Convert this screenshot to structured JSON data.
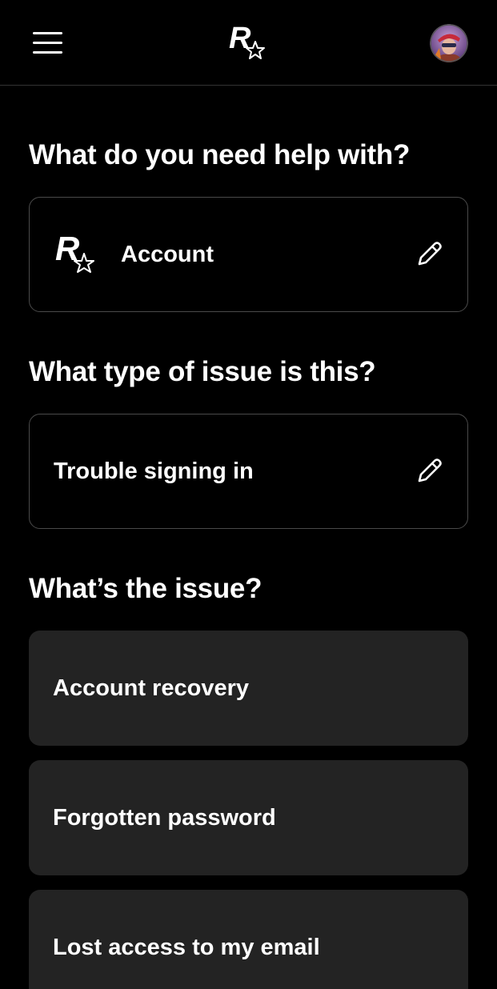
{
  "header": {
    "menu_icon": "hamburger-menu-icon",
    "logo_icon": "rockstar-logo-icon",
    "avatar_icon": "user-avatar"
  },
  "help_topic": {
    "title": "What do you need help with?",
    "selected_label": "Account",
    "edit_icon": "pencil-icon"
  },
  "issue_type": {
    "title": "What type of issue is this?",
    "selected_label": "Trouble signing in",
    "edit_icon": "pencil-icon"
  },
  "issue": {
    "title": "What’s the issue?",
    "options": [
      {
        "label": "Account recovery"
      },
      {
        "label": "Forgotten password"
      },
      {
        "label": "Lost access to my email"
      }
    ]
  },
  "colors": {
    "background": "#000000",
    "card_border": "#4a4a4a",
    "option_bg": "#232323",
    "text": "#ffffff"
  }
}
